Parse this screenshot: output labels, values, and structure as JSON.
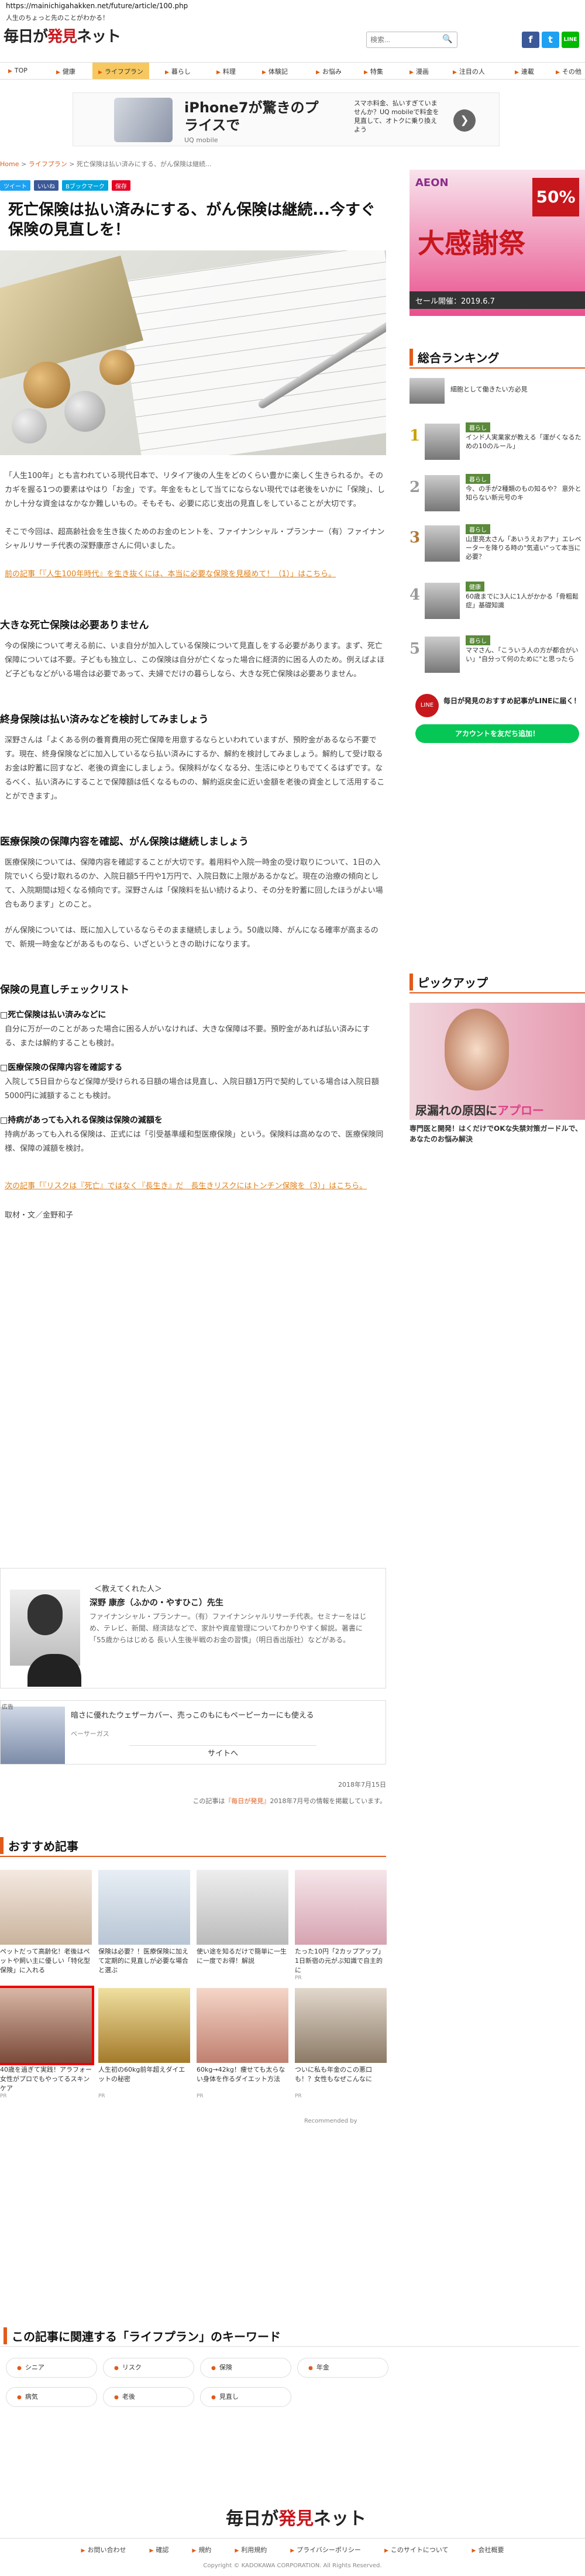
{
  "url": "https://mainichigahakken.net/future/article/100.php",
  "tagline": "人生のちょっと先のことがわかる！",
  "logo": {
    "part1": "毎日が",
    "part2": "発見",
    "part3": "ネット"
  },
  "search": {
    "placeholder": "検索..."
  },
  "nav": [
    {
      "label": "TOP"
    },
    {
      "label": "健康"
    },
    {
      "label": "ライフプラン"
    },
    {
      "label": "暮らし"
    },
    {
      "label": "料理"
    },
    {
      "label": "体験記"
    },
    {
      "label": "お悩み"
    },
    {
      "label": "特集"
    },
    {
      "label": "漫画"
    },
    {
      "label": "注目の人"
    },
    {
      "label": "連載"
    },
    {
      "label": "その他"
    }
  ],
  "ad_top": {
    "title": "iPhone7が驚きのプライスで",
    "sub": "UQ mobile",
    "desc": "スマホ料金、払いすぎていませんか？UQ mobileで料金を見直して、オトクに乗り換えよう"
  },
  "breadcrumb": {
    "home": "Home",
    "cat": "ライフプラン",
    "current": "死亡保険は払い済みにする、がん保険は継続..."
  },
  "share": [
    "ツイート",
    "いいね",
    "Bブックマーク",
    "保存"
  ],
  "article": {
    "title": "死亡保険は払い済みにする、がん保険は継続...今すぐ保険の見直しを！",
    "p1": "「人生100年」とも言われている現代日本で、リタイア後の人生をどのくらい豊かに楽しく生きられるか。そのカギを握る1つの要素はやはり「お金」です。年金をもとして当てにならない現代では老後をいかに「保険」、しかし十分な資金はなかなか難しいもの。そもそも、必要に応じ支出の見直しをしていることが大切です。",
    "p2": "そこで今回は、超高齢社会を生き抜くためのお金のヒントを、ファイナンシャル・プランナー（有）ファイナンシャルリサーチ代表の深野康彦さんに伺いました。",
    "link1": "前の記事「『人生100年時代』を生き抜くには、本当に必要な保険を見極めて！（1）」はこちら。",
    "h1": "大きな死亡保険は必要ありません",
    "p3": "今の保険について考える前に、いま自分が加入している保険について見直しをする必要があります。まず、死亡保障については不要。子どもも独立し、この保険は自分が亡くなった場合に経済的に困る人のため。例えばよほど子どもなどがいる場合は必要であって、夫婦でだけの暮らしなら、大きな死亡保険は必要ありません。",
    "h2": "終身保険は払い済みなどを検討してみましょう",
    "p4": "深野さんは「よくある例の養育費用の死亡保障を用意するならといわれていますが、預貯金があるなら不要です。現在、終身保険などに加入しているなら払い済みにするか、解約を検討してみましょう。解約して受け取るお金は貯蓄に回すなど、老後の資金にしましょう。保険料がなくなる分、生活にゆとりもでてくるはずです。なるべく、払い済みにすることで保障額は低くなるものの、解約返戻金に近い金額を老後の資金として活用することができます」。",
    "h3": "医療保険の保障内容を確認、がん保険は継続しましょう",
    "p5": "医療保険については、保障内容を確認することが大切です。着用料や入院一時金の受け取りについて、1日の入院でいくら受け取れるのか、入院日額5千円や1万円で、入院日数に上限があるかなど。現在の治療の傾向として、入院期間は短くなる傾向です。深野さんは「保険料を払い続けるより、その分を貯蓄に回したほうがよい場合もあります」とのこと。",
    "p6": "がん保険については、既に加入しているならそのまま継続しましょう。50歳以降、がんになる確率が高まるので、新規一時金などがあるものなら、いざというときの助けになります。",
    "h4": "保険の見直しチェックリスト",
    "c1": "□死亡保険は払い済みなどに",
    "c1d": "自分に万が一のことがあった場合に困る人がいなければ、大きな保障は不要。預貯金があれば払い済みにする、または解約することも検討。",
    "c2": "□医療保険の保障内容を確認する",
    "c2d": "入院して5日目からなど保障が受けられる日額の場合は見直し、入院日額1万円で契約している場合は入院日額5000円に減額することも検討。",
    "c3": "□持病があっても入れる保険は保険の減額を",
    "c3d": "持病があっても入れる保険は、正式には「引受基準緩和型医療保険」という。保険料は高めなので、医療保険同様、保障の減額を検討。",
    "link2": "次の記事「『リスクは『死亡』ではなく『長生き』だ　長生きリスクにはトンチン保険を（3）」はこちら。",
    "credit": "取材・文／金野和子"
  },
  "author": {
    "about": "＜教えてくれた人＞",
    "name": "深野 康彦（ふかの・やすひこ）先生",
    "desc": "ファイナンシャル・プランナー。（有）ファイナンシャルリサーチ代表。セミナーをはじめ、テレビ、新聞、経済誌などで、家計や資産管理についてわかりやすく解説。著書に「55歳からはじめる 長い人生後半戦のお金の習慣」（明日香出版社）などがある。"
  },
  "ad_mid": {
    "tag": "広告",
    "text": "暗さに優れたウェザーカバー、売っこのもにもペーピーカーにも使える",
    "sponsor": "ベーサーガス",
    "cta": "サイトへ"
  },
  "date": "2018年7月15日",
  "note": {
    "pre": "この記事は",
    "link": "『毎日が発見』",
    "post": "2018年7月号の情報を掲載しています。"
  },
  "recommend": {
    "title": "おすすめ記事",
    "items": [
      {
        "text": "ペットだって高齢化！老後はペットや飼い主に優しい「特化型保険」に入れる",
        "src": ""
      },
      {
        "text": "保険は必要？！医療保険に加えて定期的に見直しが必要な場合と選ぶ",
        "src": ""
      },
      {
        "text": "使い途を知るだけで簡単に一生に一度でお得！解説",
        "src": ""
      },
      {
        "text": "たった10円「2カップアップ」1日新宿の元がぶ知識で自主的に",
        "src": "PR"
      },
      {
        "text": "40歳を過ぎて実践！アラフォー女性がプロでもやってるスキンケア",
        "src": "PR"
      },
      {
        "text": "人生初の60kg前年超えダイエットの秘密",
        "src": "PR"
      },
      {
        "text": "60kg→42kg！痩せても太らない身体を作るダイエット方法",
        "src": "PR"
      },
      {
        "text": "ついに私も年金のこの悪口も！？女性もなぜこんなに",
        "src": "PR"
      }
    ],
    "powered": "Recommended by"
  },
  "keywords": {
    "title": "この記事に関連する「ライフプラン」のキーワード",
    "items": [
      "シニア",
      "リスク",
      "保険",
      "年金",
      "病気",
      "老後",
      "見直し"
    ]
  },
  "footer": {
    "links": [
      "お問い合わせ",
      "確認",
      "規約",
      "利用規約",
      "プライバシーポリシー",
      "このサイトについて",
      "会社概要"
    ],
    "copyright": "Copyright © KADOKAWA CORPORATION. All Rights Reserved."
  },
  "aeon": {
    "brand": "AEON",
    "pct": "50%",
    "big": "大感謝祭",
    "sale": "セール開催：2019.6.7"
  },
  "ranking": {
    "title": "総合ランキング",
    "items": [
      {
        "num": "",
        "cat": "",
        "text": "細胞として働きたい方必見"
      },
      {
        "num": "1",
        "cat": "暮らし",
        "text": "インド人実業家が教える「運がくなるための10のルール」"
      },
      {
        "num": "2",
        "cat": "暮らし",
        "text": "今、の手が2種類のもの知るや？ 意外と知らない新元号のキ"
      },
      {
        "num": "3",
        "cat": "暮らし",
        "text": "山里亮太さん「あいうえおアナ」エレベーターを降りる時の\"気遣い\"って本当に必要？"
      },
      {
        "num": "4",
        "cat": "健康",
        "text": "60歳までに3人に1人がかかる「骨粗鬆症」基礎知識"
      },
      {
        "num": "5",
        "cat": "暮らし",
        "text": "ママさん、「こういう人の方が都合がいい」\"自分って何のために\"と思ったら"
      }
    ]
  },
  "line_box": {
    "circle": "LINE",
    "text": "毎日が発見のおすすめ記事がLINEに届く！",
    "btn": "アカウントを友だち追加！"
  },
  "pickup": {
    "title": "ピックアップ",
    "cap1": "尿漏れの原因に",
    "cap2": "アプロー",
    "text": "専門医と開発！はくだけでOKな失禁対策ガードルで、あなたのお悩み解決"
  }
}
